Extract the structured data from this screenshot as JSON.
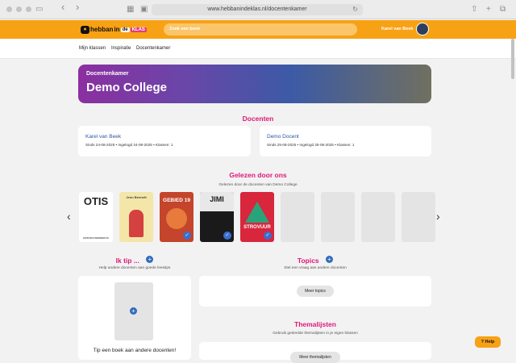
{
  "browser": {
    "url": "www.hebbanindeklas.nl/docentenkamer",
    "back_icon": "‹",
    "forward_icon": "›",
    "reload_icon": "↻",
    "share_icon": "⇧",
    "newtab_icon": "+",
    "tabs_icon": "⧉"
  },
  "site": {
    "logo_part1": "hebban",
    "logo_part2": "in",
    "logo_part3": "de",
    "logo_part4": "KLAS",
    "search_placeholder": "Zoek een boek",
    "user_name": "Karel van Beek"
  },
  "nav": {
    "items": [
      "Mijn klassen",
      "Inspiratie",
      "Docentenkamer"
    ]
  },
  "hero": {
    "kicker": "Docentenkamer",
    "title": "Demo College"
  },
  "docenten": {
    "heading": "Docenten",
    "people": [
      {
        "name": "Karel van Beek",
        "meta": "Sinds 24-08-2025 • Ingelogd 24-08-2025 • Klassen: 1"
      },
      {
        "name": "Demo Docent",
        "meta": "Sinds 25-08-2025 • Ingelogd 25-08-2025 • Klassen: 1"
      }
    ]
  },
  "gelezen": {
    "heading": "Gelezen door ons",
    "subheading": "Gelezen door de docenten van Demo College",
    "books": [
      {
        "title": "OTIS",
        "author": "KRISTEN WERNERUS",
        "color": "#ffffff",
        "text_color": "#222"
      },
      {
        "title": "Jenn Bennett",
        "author": "",
        "color": "#f3e6a8",
        "text_color": "#444"
      },
      {
        "title": "GEBIED 19",
        "author": "",
        "color": "#c4442c",
        "text_color": "#fff"
      },
      {
        "title": "JIMI",
        "author": "",
        "color": "#1a1a1a",
        "text_color": "#fff"
      },
      {
        "title": "STROVUUR",
        "author": "",
        "color": "#d8263c",
        "text_color": "#fff"
      }
    ],
    "empty_slots": 4,
    "check_icon": "✓",
    "prev_icon": "‹",
    "next_icon": "›"
  },
  "iktip": {
    "heading": "Ik tip ...",
    "subheading": "Help andere docenten aan goede leestips",
    "card_text": "Tip een boek aan andere docenten!",
    "plus_icon": "+"
  },
  "topics": {
    "heading": "Topics",
    "subheading": "Stel een vraag aan andere docenten",
    "button": "Meer topics",
    "plus_icon": "+"
  },
  "themalijsten": {
    "heading": "Themalijsten",
    "subheading": "Gebruik gedeelde themalijsten in je eigen klassen",
    "button": "Meer themalijsten"
  },
  "help": {
    "label": "? Help"
  },
  "colors": {
    "brand_orange": "#f7a114",
    "accent_pink": "#e0177a",
    "link_blue": "#2a55a0"
  }
}
